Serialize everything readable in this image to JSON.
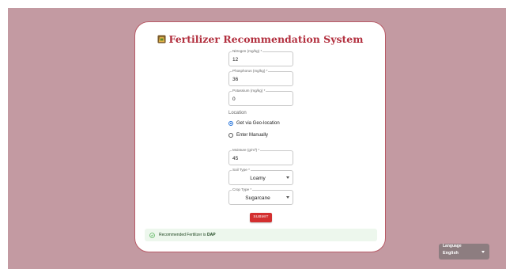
{
  "app": {
    "title": "Fertilizer Recommendation System",
    "logo_icon": "sack-icon"
  },
  "form": {
    "nitrogen": {
      "label": "Nitrogen (mg/kg) *",
      "value": "12"
    },
    "phosphorus": {
      "label": "Phosphorus (mg/kg) *",
      "value": "36"
    },
    "potassium": {
      "label": "Potassium (mg/kg) *",
      "value": "0"
    },
    "location": {
      "label": "Location",
      "options": [
        {
          "label": "Get via Geo-location",
          "checked": true
        },
        {
          "label": "Enter Manually",
          "checked": false
        }
      ]
    },
    "moisture": {
      "label": "Moisture (g/m³) *",
      "value": "45"
    },
    "soil_type": {
      "label": "Soil Type *",
      "value": "Loamy"
    },
    "crop_type": {
      "label": "Crop Type *",
      "value": "Sugarcane"
    },
    "submit_label": "SUBMIT"
  },
  "result": {
    "text": "Recommended Fertilizer is",
    "value": "DAP"
  },
  "language": {
    "label": "Language",
    "value": "English"
  },
  "colors": {
    "background": "#c39aa2",
    "accent": "#b22f3e",
    "button": "#d32f2f",
    "success_bg": "#edf7ed",
    "radio_selected": "#1e6fd9"
  }
}
